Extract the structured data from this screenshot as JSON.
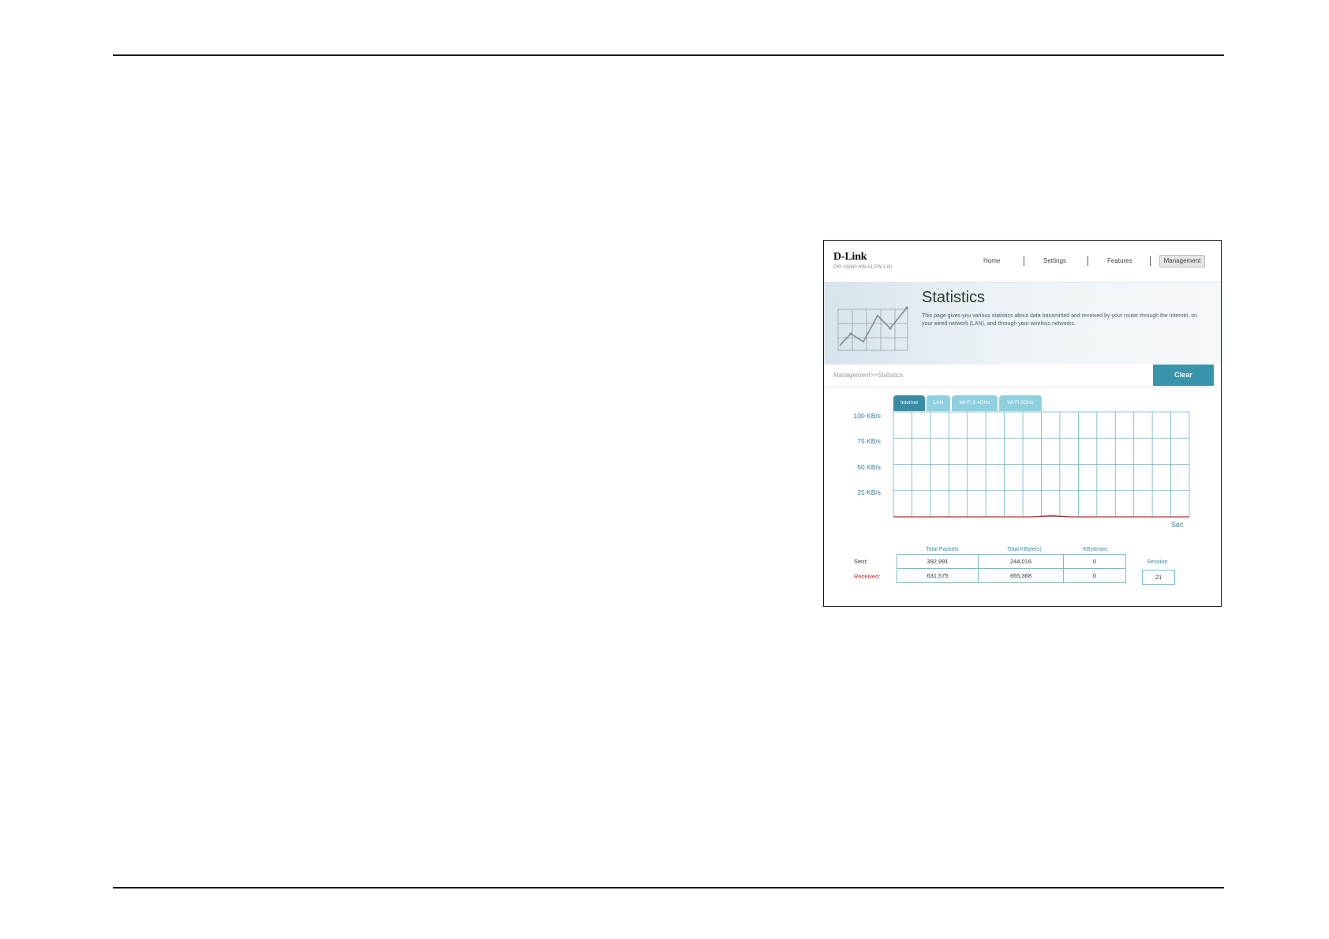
{
  "ui": {
    "logo": "D-Link",
    "model": "DIR-X6060 HW:A1 FW:1.00",
    "nav": {
      "home": "Home",
      "settings": "Settings",
      "features": "Features",
      "management": "Management"
    },
    "title": "Statistics",
    "description": "This page gives you various statistics about data transmitted and received by your router through the Internet, on your wired network (LAN), and through your wireless networks.",
    "breadcrumb": "Management>>Statistics",
    "clear_label": "Clear",
    "tabs": [
      "Internet",
      "LAN",
      "Wi-Fi 2.4GHz",
      "Wi-Fi 5GHz"
    ],
    "active_tab": "Internet",
    "x_unit_label": "Sec",
    "stats": {
      "headers": [
        "Total Packets",
        "Total KByte(s)",
        "KByte/sec"
      ],
      "sent_label": "Sent:",
      "received_label": "Received:",
      "sent": [
        "392,991",
        "244,016",
        "0"
      ],
      "received": [
        "631,575",
        "665,368",
        "0"
      ],
      "session_label": "Session",
      "session_value": "21"
    },
    "colors": {
      "accent": "#3a94ac",
      "tab_active": "#3a8ca2",
      "tab_inactive": "#8fd0df",
      "grid": "#5fb6c8",
      "received_line": "#c0272d"
    }
  },
  "chart_data": {
    "type": "line",
    "y_tick_labels": [
      "100 KB/s",
      "75 KB/s",
      "50 KB/s",
      "25 KB/s"
    ],
    "ylim": [
      0,
      100
    ],
    "series": [
      {
        "values": [
          0,
          0,
          0,
          0,
          0,
          0,
          0,
          0,
          1,
          0,
          0,
          0,
          0,
          0,
          0,
          0
        ]
      }
    ]
  }
}
